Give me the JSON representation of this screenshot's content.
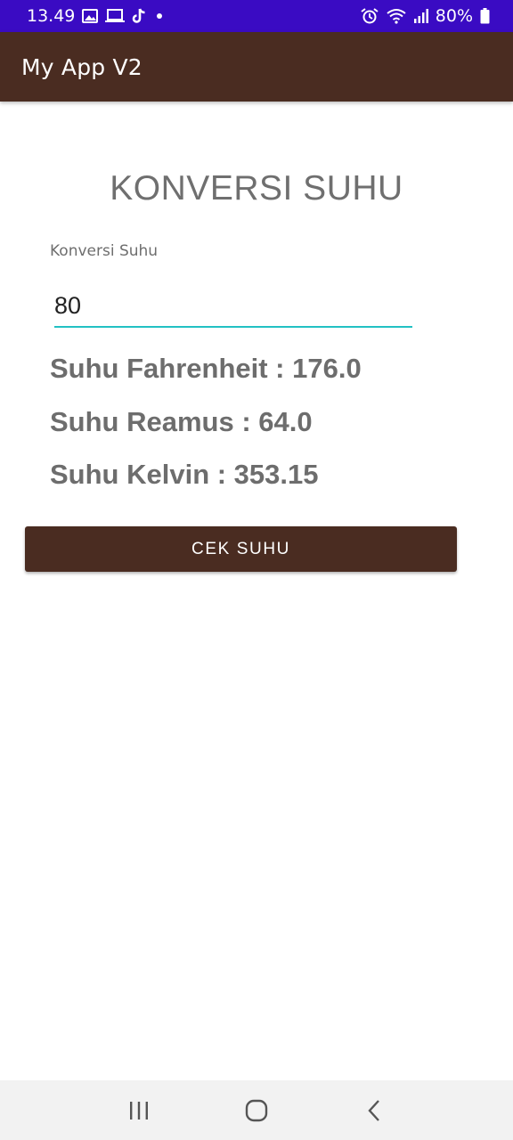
{
  "status_bar": {
    "time": "13.49",
    "battery": "80%",
    "icons_left": [
      "gallery-icon",
      "laptop-icon",
      "tiktok-icon",
      "dot-icon"
    ],
    "icons_right": [
      "alarm-icon",
      "wifi-icon",
      "signal-icon",
      "battery-icon"
    ]
  },
  "app_bar": {
    "title": "My App V2"
  },
  "main": {
    "heading": "KONVERSI SUHU",
    "input_label": "Konversi Suhu",
    "input_value": "80",
    "results": {
      "fahrenheit": "Suhu Fahrenheit : 176.0",
      "reamur": "Suhu Reamus : 64.0",
      "kelvin": "Suhu Kelvin : 353.15"
    },
    "button_label": "CEK SUHU"
  },
  "nav_bar": {
    "items": [
      "recents-icon",
      "home-icon",
      "back-icon"
    ]
  },
  "colors": {
    "status_bar": "#3a0bc3",
    "app_bar": "#4a2c21",
    "accent_underline": "#22c1c3",
    "button": "#4a2c21",
    "text_gray": "#6d6d6d"
  }
}
